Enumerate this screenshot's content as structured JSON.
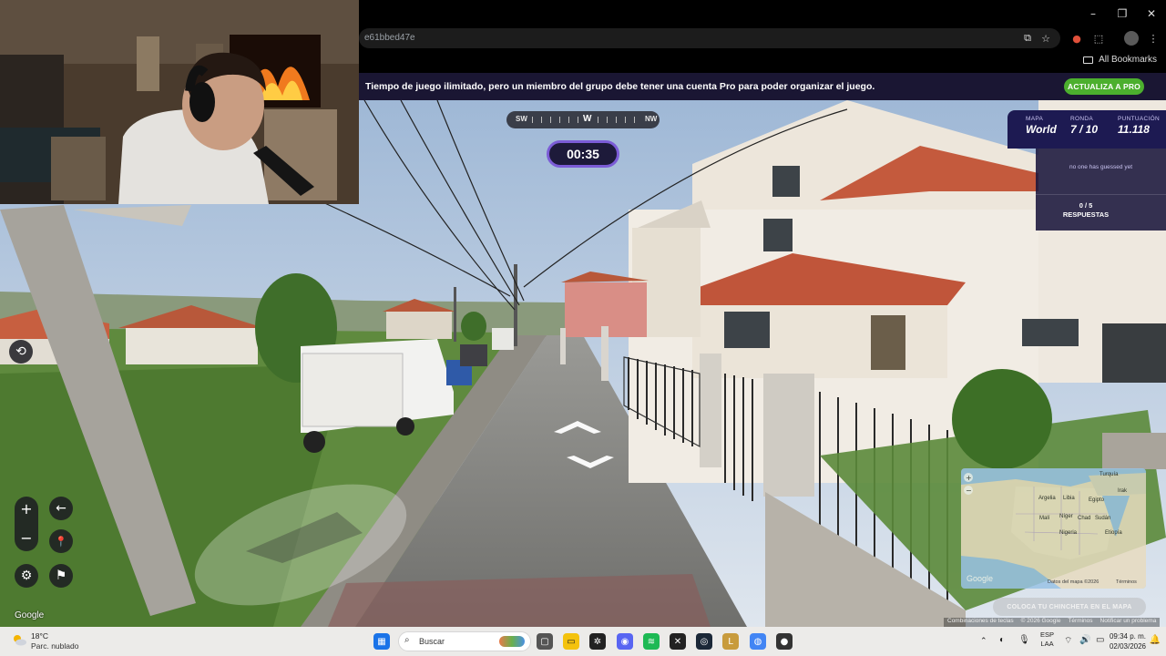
{
  "browser": {
    "url_fragment": "e61bbed47e",
    "bookmarks_label": "All Bookmarks",
    "window_controls": [
      "minimize-icon",
      "restore-icon",
      "close-icon"
    ]
  },
  "promo": {
    "text": "Tiempo de juego ilimitado, pero un miembro del grupo debe tener una cuenta Pro para poder organizar el juego.",
    "button": "ACTUALIZA A PRO",
    "button_color": "#4caf2e"
  },
  "compass": {
    "left": "SW",
    "center": "W",
    "right": "NW"
  },
  "timer": "00:35",
  "score": {
    "map_label": "MAPA",
    "map_value": "World",
    "round_label": "RONDA",
    "round_value": "7 / 10",
    "points_label": "PUNTUACIÓN",
    "points_value": "11.118",
    "accent": "#1d1a52"
  },
  "guesses": {
    "none_text": "no one has guessed yet",
    "count": "0 / 5",
    "label": "RESPUESTAS"
  },
  "controls": {
    "zoom_in": "+",
    "zoom_out": "−",
    "back": "←",
    "pin": "📍",
    "settings": "⚙",
    "flag": "⚑",
    "compass_mode": "⟲"
  },
  "google_logo": "Google",
  "minimap": {
    "button": "COLOCA TU CHINCHETA EN EL MAPA",
    "labels": [
      "Turquía",
      "Irak",
      "Argelia",
      "Libia",
      "Egipto",
      "Malí",
      "Níger",
      "Chad",
      "Sudán",
      "Nigeria",
      "Etiopía"
    ],
    "footer_logo": "Google",
    "footer_data": "Datos del mapa ©2026",
    "footer_terms": "Términos"
  },
  "attribution": {
    "shortcuts": "Combinaciones de teclas",
    "copyright": "© 2026 Google",
    "terms": "Términos",
    "report": "Notificar un problema"
  },
  "taskbar": {
    "weather_temp": "18°C",
    "weather_desc": "Parc. nublado",
    "search_placeholder": "Buscar",
    "lang_top": "ESP",
    "lang_bottom": "LAA",
    "time": "09:34 p. m.",
    "date": "02/03/2026"
  }
}
